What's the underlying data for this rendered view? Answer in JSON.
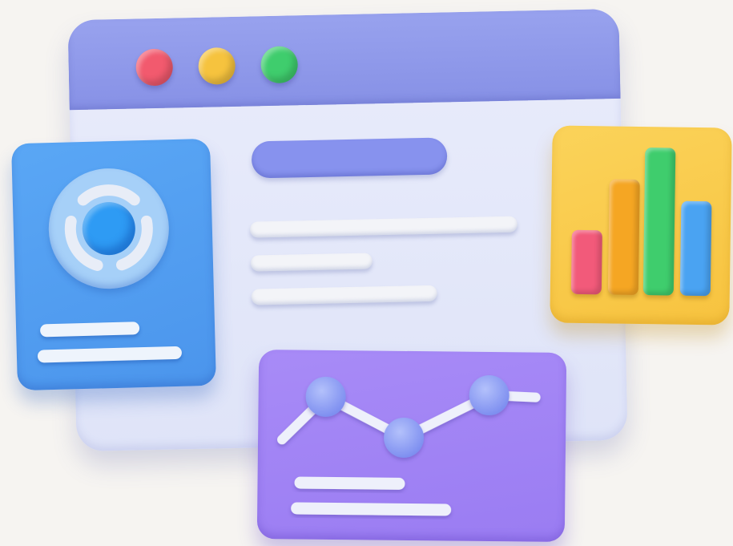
{
  "window_controls": {
    "close_color": "#f25a6e",
    "minimize_color": "#f6c33e",
    "maximize_color": "#3fcd6d"
  },
  "icons": {
    "dashboard_card": "donut-chart-icon",
    "analytics_card": "bar-chart-icon",
    "trend_card": "line-chart-icon"
  },
  "colors": {
    "window_titlebar": "#8f99ea",
    "window_body": "#e5e9f9",
    "headline": "#8792ee",
    "blue_card": "#4f9bef",
    "yellow_card": "#f9cb4a",
    "purple_card": "#a184f5",
    "bar_1": "#f25a7a",
    "bar_2": "#f5a623",
    "bar_3": "#3fcd6d",
    "bar_4": "#4aa3f2"
  }
}
